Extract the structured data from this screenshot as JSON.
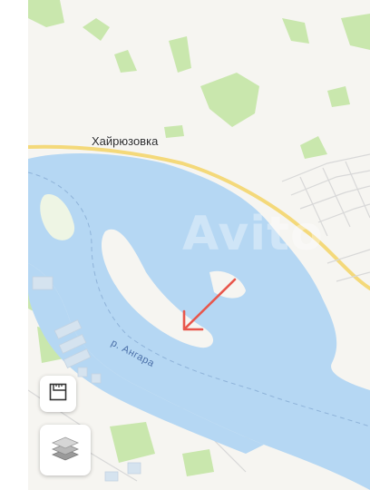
{
  "map": {
    "place_label": "Хайрюзовка",
    "river_label": "р. Ангара",
    "watermark": "Avito",
    "colors": {
      "land": "#f6f5f1",
      "water": "#b4d6f2",
      "green": "#c7e6ab",
      "road": "#f7e08a",
      "arrow": "#e8564b"
    }
  },
  "controls": {
    "ruler_icon": "ruler-icon",
    "layers_icon": "layers-icon"
  }
}
